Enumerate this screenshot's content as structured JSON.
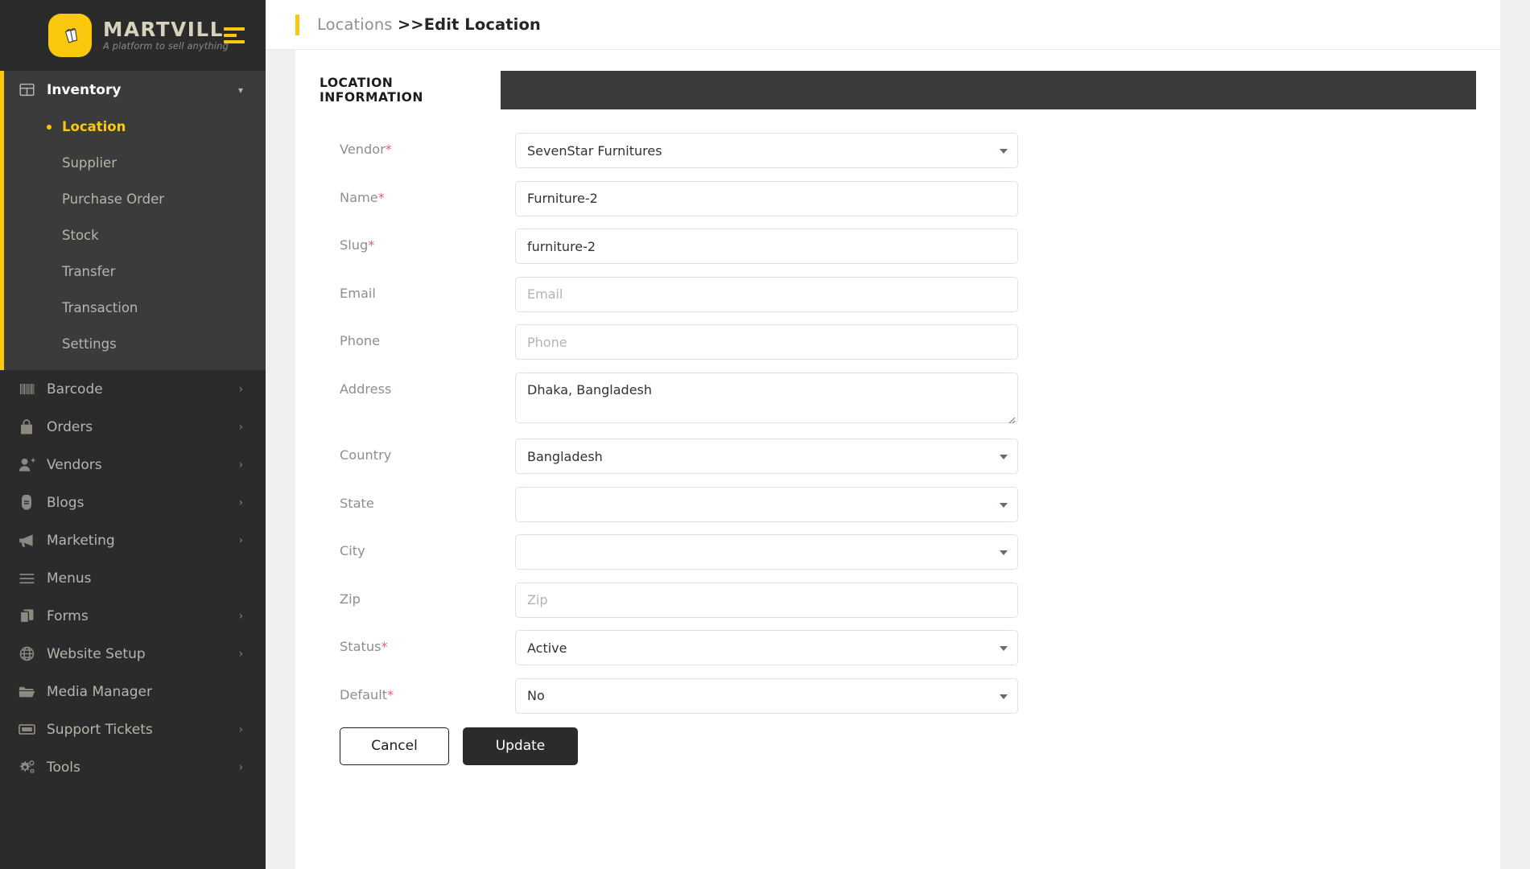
{
  "brand": {
    "name": "MARTVILL",
    "tagline": "A platform to sell anything",
    "logo_icon": "shopping-bags-icon",
    "collapse_icon": "menu-collapse-icon",
    "accent_color": "#fac90d"
  },
  "sidebar": {
    "groups": [
      {
        "label": "Inventory",
        "icon": "grid-icon",
        "active": true,
        "expanded": true,
        "chevron": "chevron-down-icon",
        "children": [
          {
            "label": "Location",
            "current": true
          },
          {
            "label": "Supplier",
            "current": false
          },
          {
            "label": "Purchase Order",
            "current": false
          },
          {
            "label": "Stock",
            "current": false
          },
          {
            "label": "Transfer",
            "current": false
          },
          {
            "label": "Transaction",
            "current": false
          },
          {
            "label": "Settings",
            "current": false
          }
        ]
      },
      {
        "label": "Barcode",
        "icon": "barcode-icon",
        "chevron": "chevron-right-icon"
      },
      {
        "label": "Orders",
        "icon": "bag-icon",
        "chevron": "chevron-right-icon"
      },
      {
        "label": "Vendors",
        "icon": "user-plus-icon",
        "chevron": "chevron-right-icon"
      },
      {
        "label": "Blogs",
        "icon": "blog-icon",
        "chevron": "chevron-right-icon"
      },
      {
        "label": "Marketing",
        "icon": "megaphone-icon",
        "chevron": "chevron-right-icon"
      },
      {
        "label": "Menus",
        "icon": "hamburger-icon",
        "chevron": ""
      },
      {
        "label": "Forms",
        "icon": "copy-icon",
        "chevron": "chevron-right-icon"
      },
      {
        "label": "Website Setup",
        "icon": "globe-icon",
        "chevron": "chevron-right-icon"
      },
      {
        "label": "Media Manager",
        "icon": "folder-open-icon",
        "chevron": ""
      },
      {
        "label": "Support Tickets",
        "icon": "ticket-icon",
        "chevron": "chevron-right-icon"
      },
      {
        "label": "Tools",
        "icon": "gears-icon",
        "chevron": "chevron-right-icon"
      }
    ]
  },
  "breadcrumb": {
    "parent": "Locations ",
    "current": ">>Edit Location"
  },
  "tabs": [
    {
      "label": "LOCATION INFORMATION",
      "active": true
    }
  ],
  "form": {
    "fields": [
      {
        "label": "Vendor",
        "required": true,
        "type": "select",
        "value": "SevenStar Furnitures",
        "placeholder": ""
      },
      {
        "label": "Name",
        "required": true,
        "type": "text",
        "value": "Furniture-2",
        "placeholder": ""
      },
      {
        "label": "Slug",
        "required": true,
        "type": "text",
        "value": "furniture-2",
        "placeholder": ""
      },
      {
        "label": "Email",
        "required": false,
        "type": "text",
        "value": "",
        "placeholder": "Email"
      },
      {
        "label": "Phone",
        "required": false,
        "type": "text",
        "value": "",
        "placeholder": "Phone"
      },
      {
        "label": "Address",
        "required": false,
        "type": "textarea",
        "value": "Dhaka, Bangladesh",
        "placeholder": ""
      },
      {
        "label": "Country",
        "required": false,
        "type": "select",
        "value": "Bangladesh",
        "placeholder": ""
      },
      {
        "label": "State",
        "required": false,
        "type": "select",
        "value": "",
        "placeholder": ""
      },
      {
        "label": "City",
        "required": false,
        "type": "select",
        "value": "",
        "placeholder": ""
      },
      {
        "label": "Zip",
        "required": false,
        "type": "text",
        "value": "",
        "placeholder": "Zip"
      },
      {
        "label": "Status",
        "required": true,
        "type": "select",
        "value": "Active",
        "placeholder": ""
      },
      {
        "label": "Default",
        "required": true,
        "type": "select",
        "value": "No",
        "placeholder": ""
      }
    ],
    "buttons": {
      "cancel": "Cancel",
      "update": "Update"
    }
  }
}
